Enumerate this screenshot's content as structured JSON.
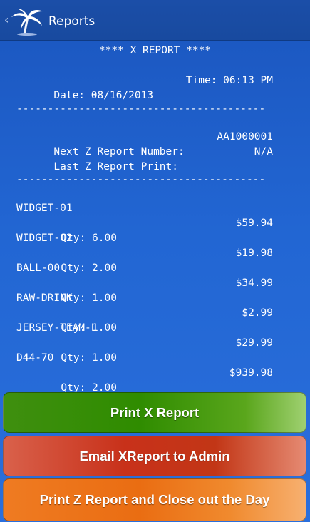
{
  "actionbar": {
    "up_glyph": "‹",
    "title": "Reports",
    "logo_icon": "palm-tree-icon"
  },
  "report": {
    "header": "**** X REPORT ****",
    "date_label": "Date: 08/16/2013",
    "time_label": "Time: 06:13 PM",
    "separator": "----------------------------------------",
    "next_z_label": "Next Z Report Number:",
    "next_z_value": "AA1000001",
    "last_z_label": "Last Z Report Print:",
    "last_z_value": "N/A",
    "items": [
      {
        "name": "WIDGET-01",
        "qty": "Qty: 6.00",
        "amount": "$59.94"
      },
      {
        "name": "WIDGET-02",
        "qty": "Qty: 2.00",
        "amount": "$19.98"
      },
      {
        "name": "BALL-00",
        "qty": "Qty: 1.00",
        "amount": "$34.99"
      },
      {
        "name": "RAW-DRINK",
        "qty": "Qty: 1.00",
        "amount": "$2.99"
      },
      {
        "name": "JERSEY-TEAM-L",
        "qty": "Qty: 1.00",
        "amount": "$29.99"
      },
      {
        "name": "D44-70",
        "qty": "Qty: 2.00",
        "amount": "$939.98"
      }
    ]
  },
  "buttons": {
    "print_x": "Print X Report",
    "email_x": "Email XReport to Admin",
    "print_z": "Print Z Report and Close out the Day"
  },
  "colors": {
    "actionbar": "#1b4ea8",
    "background": "#2266d3",
    "green": "#2f8c00",
    "red": "#c8311a",
    "orange": "#ea6d12"
  }
}
